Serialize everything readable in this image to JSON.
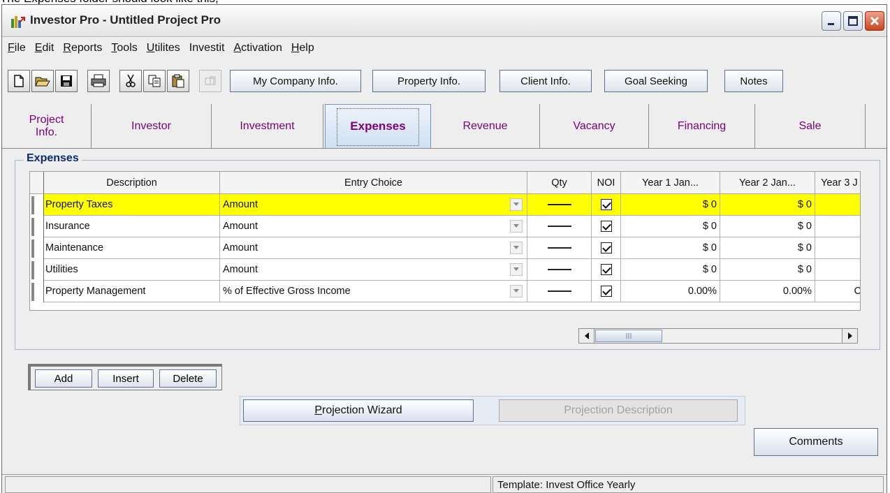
{
  "caption": "The Expenses folder should look like this,",
  "window": {
    "title": "Investor Pro  - Untitled Project Pro",
    "controls": [
      "minimize-icon",
      "maximize-icon",
      "close-icon"
    ]
  },
  "menu": [
    {
      "label": "File",
      "mnemonic": "F",
      "rest": "ile"
    },
    {
      "label": "Edit",
      "mnemonic": "E",
      "rest": "dit"
    },
    {
      "label": "Reports",
      "mnemonic": "R",
      "rest": "eports"
    },
    {
      "label": "Tools",
      "mnemonic": "T",
      "rest": "ools"
    },
    {
      "label": "Utilites",
      "mnemonic": "U",
      "rest": "tilites"
    },
    {
      "label": "Investit",
      "mnemonic": "",
      "rest": "Investit"
    },
    {
      "label": "Activation",
      "mnemonic": "A",
      "rest": "ctivation"
    },
    {
      "label": "Help",
      "mnemonic": "H",
      "rest": "elp"
    }
  ],
  "toolbar": {
    "icons": [
      "new-file-icon",
      "open-folder-icon",
      "save-icon",
      "print-icon",
      "cut-icon",
      "copy-icon",
      "paste-icon",
      "disabled-icon"
    ],
    "buttons": {
      "company": "My Company Info.",
      "property": "Property Info.",
      "client": "Client Info.",
      "goal": "Goal Seeking",
      "notes": "Notes"
    }
  },
  "tabs": {
    "project": "Project Info.",
    "investor": "Investor",
    "investment": "Investment",
    "expenses": "Expenses",
    "revenue": "Revenue",
    "vacancy": "Vacancy",
    "financing": "Financing",
    "sale": "Sale",
    "active": "Expenses"
  },
  "group_title": "Expenses",
  "grid": {
    "headers": {
      "description": "Description",
      "entry": "Entry Choice",
      "qty": "Qty",
      "noi": "NOI",
      "y1": "Year 1 Jan...",
      "y2": "Year 2 Jan...",
      "y3": "Year 3 J"
    },
    "rows": [
      {
        "description": "Property Taxes",
        "entry": "Amount",
        "noi": true,
        "y1": "$ 0",
        "y2": "$ 0",
        "y3": "",
        "highlight": true
      },
      {
        "description": "Insurance",
        "entry": "Amount",
        "noi": true,
        "y1": "$ 0",
        "y2": "$ 0",
        "y3": "",
        "highlight": false
      },
      {
        "description": "Maintenance",
        "entry": "Amount",
        "noi": true,
        "y1": "$ 0",
        "y2": "$ 0",
        "y3": "",
        "highlight": false
      },
      {
        "description": "Utilities",
        "entry": "Amount",
        "noi": true,
        "y1": "$ 0",
        "y2": "$ 0",
        "y3": "",
        "highlight": false
      },
      {
        "description": "Property Management",
        "entry": "% of Effective Gross Income",
        "noi": true,
        "y1": "0.00%",
        "y2": "0.00%",
        "y3": "C",
        "highlight": false
      }
    ],
    "highlight_color": "#ffff00"
  },
  "row_buttons": {
    "add": "Add",
    "insert": "Insert",
    "delete": "Delete"
  },
  "projection": {
    "wizard": "Projection Wizard",
    "description": "Projection Description"
  },
  "comments": "Comments",
  "status": {
    "left": "",
    "template": "Template: Invest Office Yearly"
  },
  "colors": {
    "tab_text": "#7b007b",
    "legend": "#0b2a7a",
    "active_tab_bg": "#cfdff2"
  }
}
